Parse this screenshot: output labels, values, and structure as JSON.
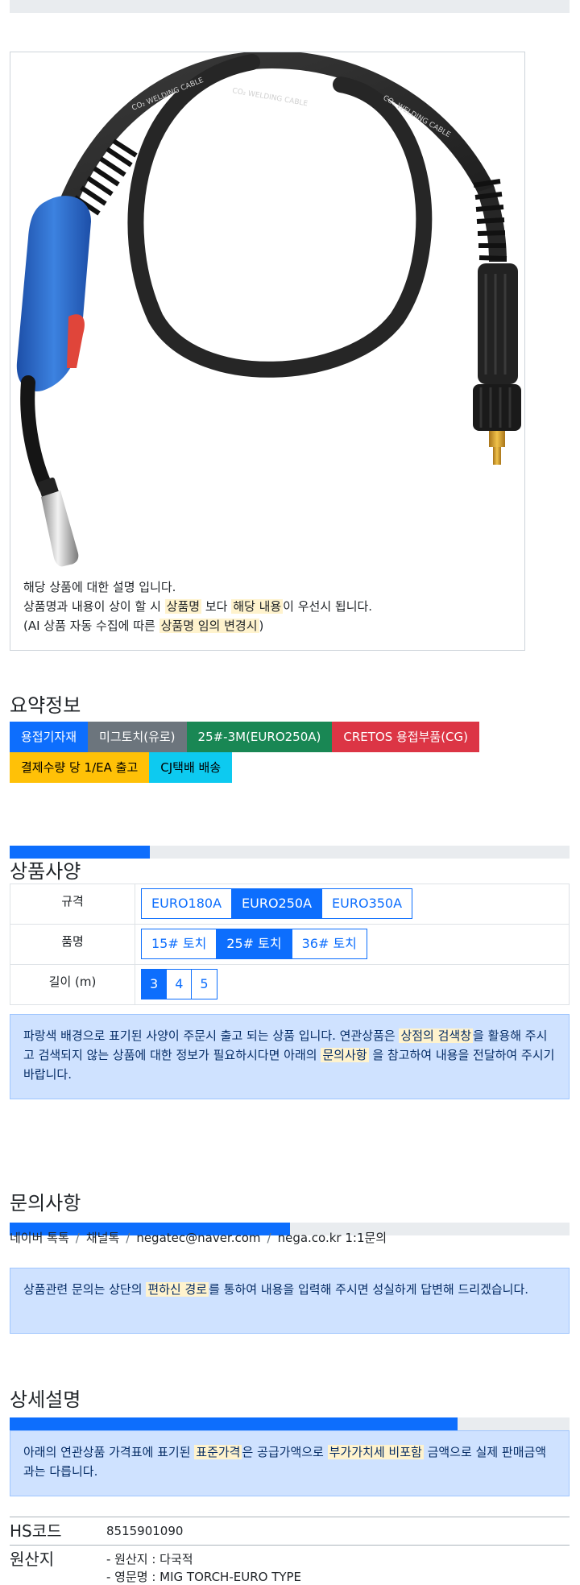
{
  "image_description": {
    "lines": [
      [
        "해당 상품에 대한 설명 입니다."
      ],
      [
        "상품명과 내용이 상이 할 시 ",
        {
          "hl": "상품명"
        },
        " 보다 ",
        {
          "hl": "해당 내용"
        },
        "이 우선시 됩니다."
      ],
      [
        "(AI 상품 자동 수집에 따른 ",
        {
          "hl": "상품명 임의 변경시"
        },
        ")"
      ]
    ]
  },
  "summary": {
    "title": "요약정보",
    "badges": [
      {
        "label": "용접기자재",
        "color": "#0d6efd"
      },
      {
        "label": "미그토치(유로)",
        "color": "#6c757d"
      },
      {
        "label": "25#-3M(EURO250A)",
        "color": "#198754"
      },
      {
        "label": "CRETOS 용접부품(CG)",
        "color": "#dc3545"
      },
      {
        "label": "결제수량 당 1/EA 출고",
        "color": "#ffc107",
        "text_color": "#000000"
      },
      {
        "label": "CJ택배 배송",
        "color": "#0dcaf0",
        "text_color": "#000000"
      }
    ]
  },
  "spec": {
    "progress": 25,
    "title": "상품사양",
    "rows": [
      {
        "label": "규격",
        "options": [
          "EURO180A",
          "EURO250A",
          "EURO350A"
        ],
        "selected": 1
      },
      {
        "label": "품명",
        "options": [
          "15# 토치",
          "25# 토치",
          "36# 토치"
        ],
        "selected": 1
      },
      {
        "label": "길이 (m)",
        "options": [
          "3",
          "4",
          "5"
        ],
        "selected": 0
      }
    ],
    "note": [
      "파랑색 배경으로 표기된 사양이 주문시 출고 되는 상품 입니다. 연관상품은 ",
      {
        "hl": "상점의 검색창"
      },
      "을 활용해 주시고 검색되지 않는 상품에 대한 정보가 필요하시다면 아래의 ",
      {
        "hl": "문의사항"
      },
      " 을 참고하여 내용을 전달하여 주시기 바랍니다."
    ]
  },
  "inquiry": {
    "title": "문의사항",
    "progress": 50,
    "links": [
      "네이버 톡톡",
      "채널톡",
      "negatec@naver.com",
      "nega.co.kr 1:1문의"
    ],
    "note": [
      "상품관련 문의는 상단의 ",
      {
        "hl": "편하신 경로"
      },
      "를 통하여 내용을 입력해 주시면 성실하게 답변해 드리겠습니다."
    ]
  },
  "detail": {
    "title": "상세설명",
    "progress": 80,
    "note": [
      "아래의 연관상품 가격표에 표기된 ",
      {
        "hl": "표준가격"
      },
      "은 공급가액으로 ",
      {
        "hl": "부가가치세 비포함"
      },
      " 금액으로 실제 판매금액과는 다릅니다."
    ]
  },
  "info": {
    "hs_label": "HS코드",
    "hs_value": "8515901090",
    "origin_label": "원산지",
    "origin_lines": [
      "- 원산지 : 다국적",
      "- 영문명 : MIG TORCH-EURO TYPE"
    ]
  },
  "cable_print": [
    "CO₂ WELDING CABLE",
    "CO₂ WELDING CABLE",
    "CO₂ WELDING CABLE"
  ],
  "colors": {
    "primary": "#0d6efd",
    "alert_bg": "#cfe2ff",
    "highlight": "#fff3cd",
    "torch_handle": "#2f6fd0",
    "cable": "#2b2b2b"
  }
}
